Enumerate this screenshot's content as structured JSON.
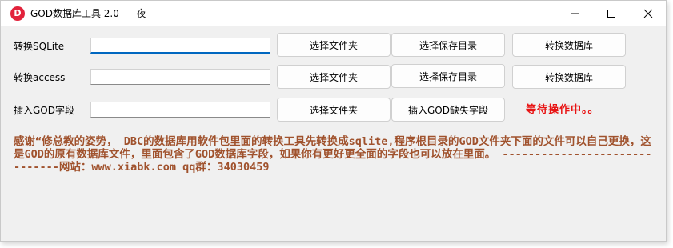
{
  "window": {
    "title": "GOD数据库工具 2.0",
    "title_extra": "-夜",
    "icon": "D"
  },
  "rows": [
    {
      "label": "转换SQLite",
      "input_value": "",
      "btn1": "选择文件夹",
      "btn2": "选择保存目录",
      "btn3": "转换数据库"
    },
    {
      "label": "转换access",
      "input_value": "",
      "btn1": "选择文件夹",
      "btn2": "选择保存目录",
      "btn3": "转换数据库"
    },
    {
      "label": "插入GOD字段",
      "input_value": "",
      "btn1": "选择文件夹",
      "btn2": "插入GOD缺失字段"
    }
  ],
  "status_text": "等待操作中。。",
  "description": "感谢“修总教的姿势， DBC的数据库用软件包里面的转换工具先转换成sqlite,程序根目录的GOD文件夹下面的文件可以自己更换，这是GOD的原有数据库文件，里面包含了GOD数据库字段，如果你有更好更全面的字段也可以放在里面。 ------------------------------网站：www.xiabk.com qq群：34030459",
  "colors": {
    "accent": "#0067c0",
    "status": "#e81414",
    "description": "#a0522d",
    "icon_bg": "#e2223b"
  }
}
